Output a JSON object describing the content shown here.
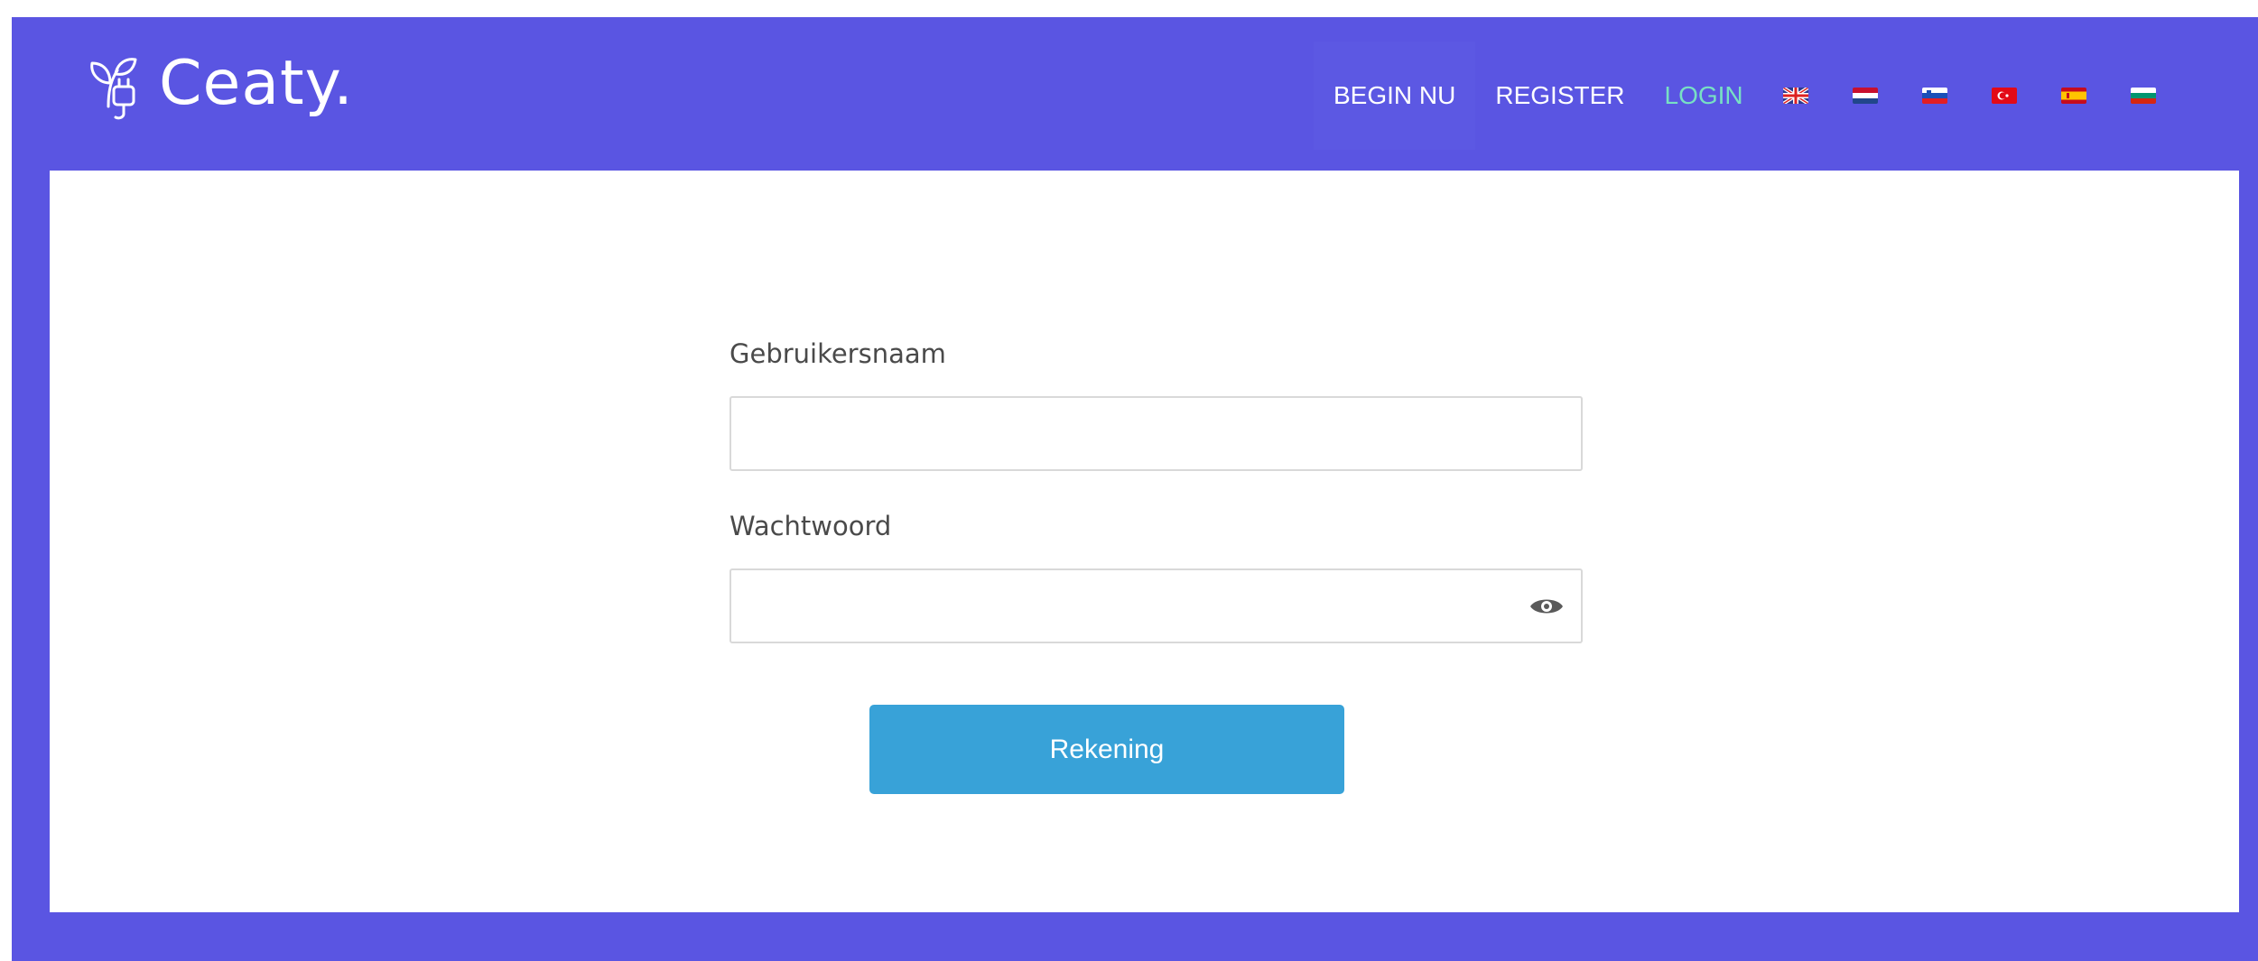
{
  "brand": {
    "name": "Ceaty."
  },
  "nav": {
    "begin_label": "BEGIN NU",
    "register_label": "REGISTER",
    "login_label": "LOGIN"
  },
  "languages": [
    "gb-flag-icon",
    "nl-flag-icon",
    "si-flag-icon",
    "tr-flag-icon",
    "es-flag-icon",
    "bg-flag-icon"
  ],
  "form": {
    "username_label": "Gebruikersnaam",
    "username_value": "",
    "password_label": "Wachtwoord",
    "password_value": "",
    "submit_label": "Rekening"
  },
  "colors": {
    "background": "#5a55e2",
    "card": "#ffffff",
    "button": "#38a2d8",
    "login_link": "#78e0c4"
  }
}
